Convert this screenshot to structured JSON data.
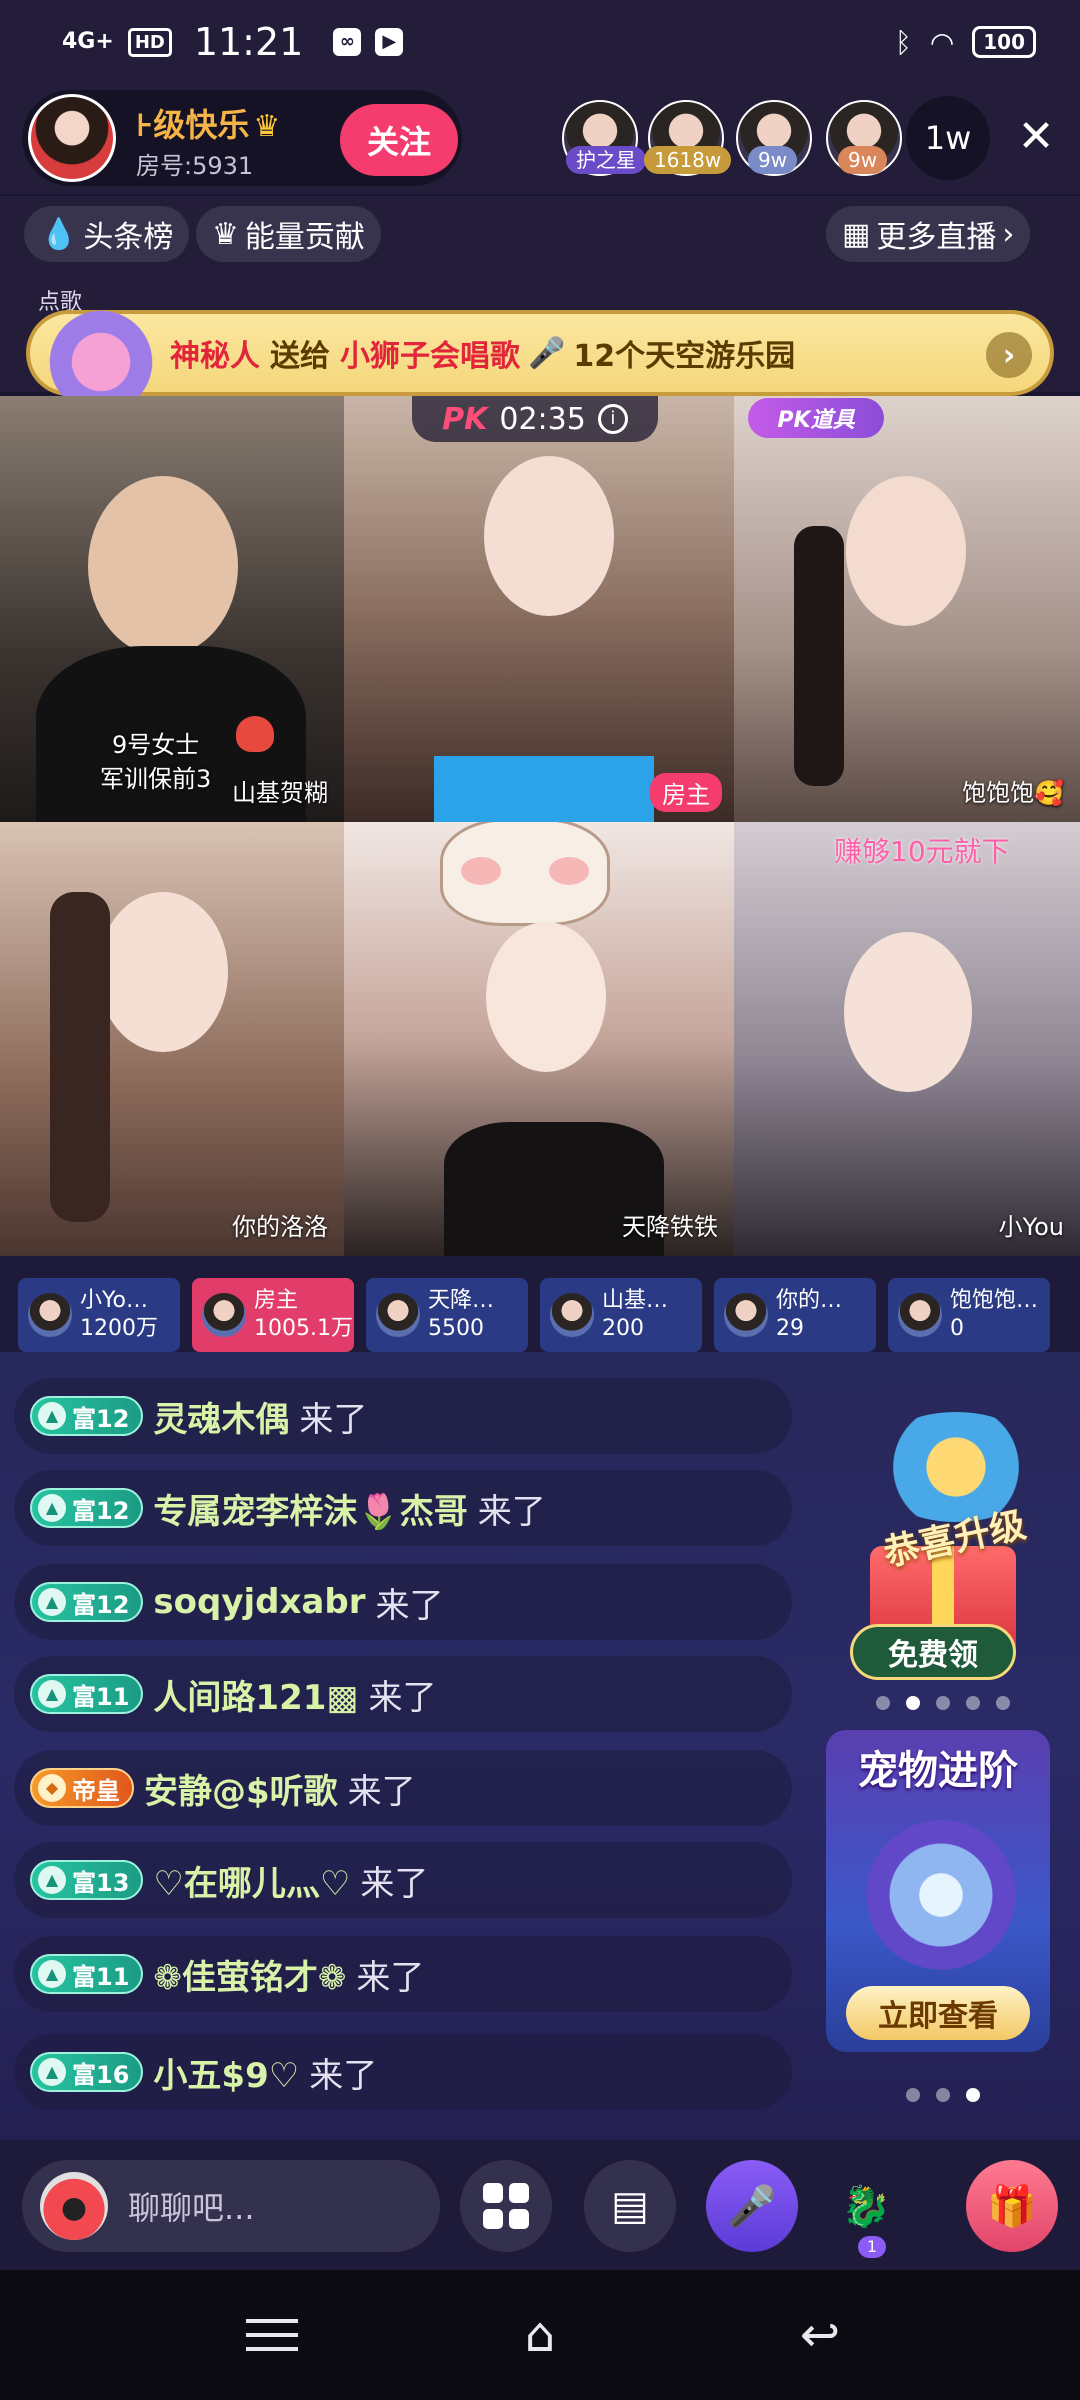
{
  "status_bar": {
    "signal": "4G+",
    "hd": "HD",
    "time": "11:21",
    "battery": "100"
  },
  "header": {
    "host_name": "⊦级快乐",
    "room_id": "房号:5931",
    "follow_label": "关注",
    "viewers": [
      {
        "tag": "护之星",
        "tag_color": "#6b4cc8"
      },
      {
        "tag": "1618w",
        "tag_color": "#c79a3c"
      },
      {
        "tag": "9w",
        "tag_color": "#7a8cc8"
      },
      {
        "tag": "9w",
        "tag_color": "#d8865a"
      }
    ],
    "viewer_count": "1w",
    "close_label": "✕"
  },
  "chips": {
    "headline": "头条榜",
    "energy": "能量贡献",
    "more_live": "更多直播"
  },
  "strip": {
    "label": "点歌"
  },
  "banner": {
    "sender": "神秘人",
    "verb": "送给",
    "receiver": "小狮子会唱歌",
    "gift": "12个天空游乐园"
  },
  "pk": {
    "logo": "PK",
    "timer": "02:35",
    "tool_label": "PK道具"
  },
  "tiles": [
    {
      "name": "山基贺糊",
      "sign_line1": "9号女士",
      "sign_line2": "军训保前3"
    },
    {
      "name": "房主"
    },
    {
      "name": "饱饱饱🥰"
    },
    {
      "name": "你的洛洛"
    },
    {
      "name": "天降铁铁"
    },
    {
      "name": "小You",
      "caption": "赚够10元就下"
    }
  ],
  "scores": [
    {
      "name": "小Yo…",
      "value": "1200万"
    },
    {
      "name": "房主",
      "value": "1005.1万"
    },
    {
      "name": "天降…",
      "value": "5500"
    },
    {
      "name": "山基…",
      "value": "200"
    },
    {
      "name": "你的…",
      "value": "29"
    },
    {
      "name": "饱饱饱…",
      "value": "0"
    }
  ],
  "chat": [
    {
      "level": "富12",
      "user": "灵魂木偶",
      "msg": "来了"
    },
    {
      "level": "富12",
      "user": "专属宠李梓沫🌷杰哥",
      "msg": "来了"
    },
    {
      "level": "富12",
      "user": "soqyjdxabr",
      "msg": "来了"
    },
    {
      "level": "富11",
      "user": "人间路121▩",
      "msg": "来了"
    },
    {
      "level": "帝皇",
      "user": "安静@$听歌",
      "msg": "来了"
    },
    {
      "level": "富13",
      "user": "♡在哪儿灬♡",
      "msg": "来了"
    },
    {
      "level": "富11",
      "user": "❁佳萤铭才❁",
      "msg": "来了"
    },
    {
      "level": "富16",
      "user": "小五$9♡",
      "msg": "来了"
    }
  ],
  "promo": {
    "upgrade_title": "恭喜升级",
    "free_label": "免费领",
    "pet_title": "宠物进阶",
    "pet_button": "立即查看"
  },
  "bottom": {
    "chat_placeholder": "聊聊吧...",
    "badge": "1"
  },
  "colors": {
    "accent_pink": "#f53c6f",
    "rich_green": "#27c3a1",
    "gold": "#f5b546"
  }
}
